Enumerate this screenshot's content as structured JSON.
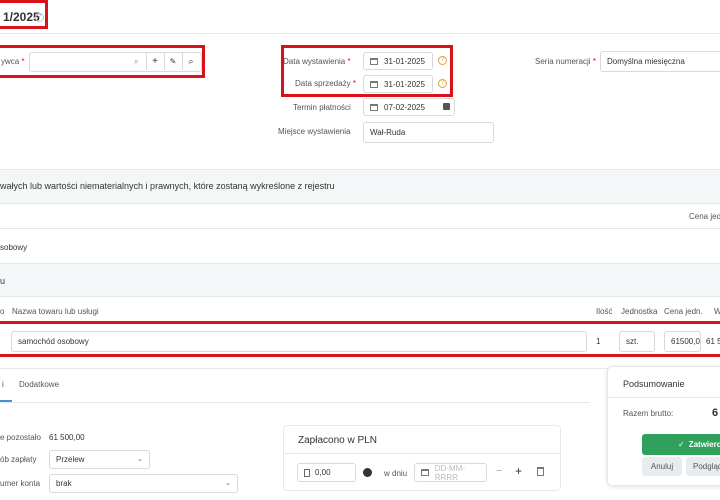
{
  "header": {
    "title_fragment": "1/2025",
    "help_glyph": "?"
  },
  "buyer": {
    "label_fragment": "ywca",
    "required_mark": "*"
  },
  "dates": {
    "issue_label": "Data wystawienia",
    "issue_value": "31-01-2025",
    "sale_label": "Data sprzedaży",
    "sale_value": "31-01-2025",
    "payment_term_label": "Termin płatności",
    "payment_term_value": "07-02-2025",
    "place_label": "Miejsce wystawienia",
    "place_value": "Wał-Ruda"
  },
  "numbering": {
    "label": "Seria numeracji",
    "value": "Domyślna miesięczna"
  },
  "section1": {
    "title": "wałych lub wartości niematerialnych i prawnych, które zostaną wykreślone z rejestru",
    "col_price": "Cena jedn",
    "row_fragment": "sobowy"
  },
  "section2": {
    "title_fragment": "u"
  },
  "items_table": {
    "col_no": "o",
    "col_name": "Nazwa towaru lub usługi",
    "col_qty": "Ilość",
    "col_unit": "Jednostka",
    "col_price": "Cena jedn.",
    "col_value_fragment": "W",
    "row": {
      "name": "samochód osobowy",
      "qty": "1",
      "unit": "szt.",
      "price": "61500,0",
      "value_fragment": "61 5"
    }
  },
  "tabs": {
    "tab_first_fragment": "i",
    "tab_additional": "Dodatkowe"
  },
  "payment": {
    "remaining_label_fragment": "e pozostało",
    "remaining_value": "61 500,00",
    "method_label_fragment": "ób zapłaty",
    "method_value": "Przelew",
    "account_label_fragment": "umer konta",
    "account_value": "brak"
  },
  "paid": {
    "title": "Zapłacono w PLN",
    "amount": "0,00",
    "in_day_label": "w dniu",
    "date_placeholder": "DD-MM-RRRR"
  },
  "summary": {
    "title": "Podsumowanie",
    "gross_label": "Razem brutto:",
    "gross_value_fragment": "6",
    "approve_label": "Zatwierd",
    "cancel_label": "Anuluj",
    "preview_label": "Podgląd"
  },
  "colors": {
    "highlight_red": "#d9111b",
    "approve_green": "#2fa15b",
    "help_orange": "#e2a23a"
  }
}
